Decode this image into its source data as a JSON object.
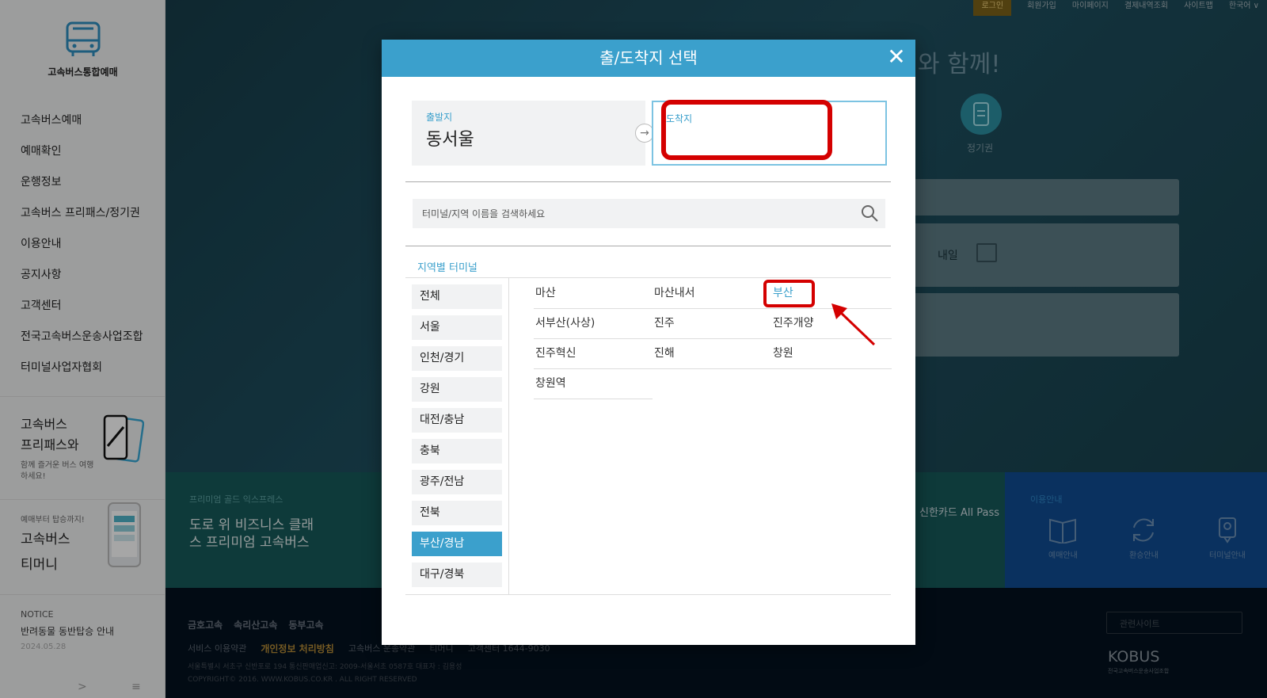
{
  "sidebar": {
    "logo_text": "고속버스통합예매",
    "menu": [
      "고속버스예매",
      "예매확인",
      "운행정보",
      "고속버스 프리패스/정기권",
      "이용안내",
      "공지사항",
      "고객센터",
      "전국고속버스운송사업조합",
      "터미널사업자협회"
    ],
    "promo1": {
      "line1": "고속버스",
      "line2": "프리패스와",
      "small": "함께 즐거운 버스 여행 하세요!"
    },
    "promo2": {
      "tiny": "예매부터 탑승까지!",
      "line1": "고속버스",
      "line2": "티머니"
    },
    "notice": {
      "label": "NOTICE",
      "title": "반려동물 동반탑승 안내",
      "date": "2024.05.28",
      "next": ">",
      "menu": "≡"
    }
  },
  "topbar": {
    "login": "로그인",
    "links": [
      "회원가입",
      "마이페이지",
      "결제내역조회",
      "사이트맵",
      "한국어 ∨"
    ]
  },
  "background": {
    "headline": "와 함께!",
    "pass_label": "정기권",
    "tomorrow": "내일",
    "premium_tag": "프리미엄 골드 익스프레스",
    "premium_title_1": "도로 위 비즈니스 클래",
    "premium_title_2": "스 프리미엄 고속버스",
    "allpass": "신한카드 All Pass",
    "use_tag": "이용안내",
    "use_items": [
      "예매안내",
      "환승안내",
      "터미널안내"
    ],
    "partners": [
      "금호고속",
      "속리산고속",
      "동부고속"
    ],
    "footer_links": [
      "서비스 이용약관",
      "개인정보 처리방침",
      "고속버스 운송약관",
      "티머니",
      "고객센터 1644-9030"
    ],
    "address": "서울특별시 서초구 신반포로 194 통신판매업신고: 2009-서울서초 0587호 대표자 : 김용성",
    "copyright": "COPYRIGHT© 2016. WWW.KOBUS.CO.KR . ALL RIGHT RESERVED",
    "related": "관련사이트",
    "kobus": "KOBUS",
    "kobus_sub": "전국고속버스운송사업조합"
  },
  "modal": {
    "title": "출/도착지 선택",
    "close": "✕",
    "origin_label": "출발지",
    "origin_value": "동서울",
    "swap": "→",
    "dest_label": "도착지",
    "dest_value": "",
    "search_placeholder": "터미널/지역 이름을 검색하세요",
    "region_title": "지역별 터미널",
    "regions": [
      "전체",
      "서울",
      "인천/경기",
      "강원",
      "대전/충남",
      "충북",
      "광주/전남",
      "전북",
      "부산/경남",
      "대구/경북"
    ],
    "active_region": "부산/경남",
    "terminals": [
      "마산",
      "마산내서",
      "부산",
      "서부산(사상)",
      "진주",
      "진주개양",
      "진주혁신",
      "진해",
      "창원",
      "창원역"
    ],
    "selected_terminal": "부산"
  },
  "colors": {
    "accent": "#3ba0cc",
    "highlight": "#d40000"
  }
}
